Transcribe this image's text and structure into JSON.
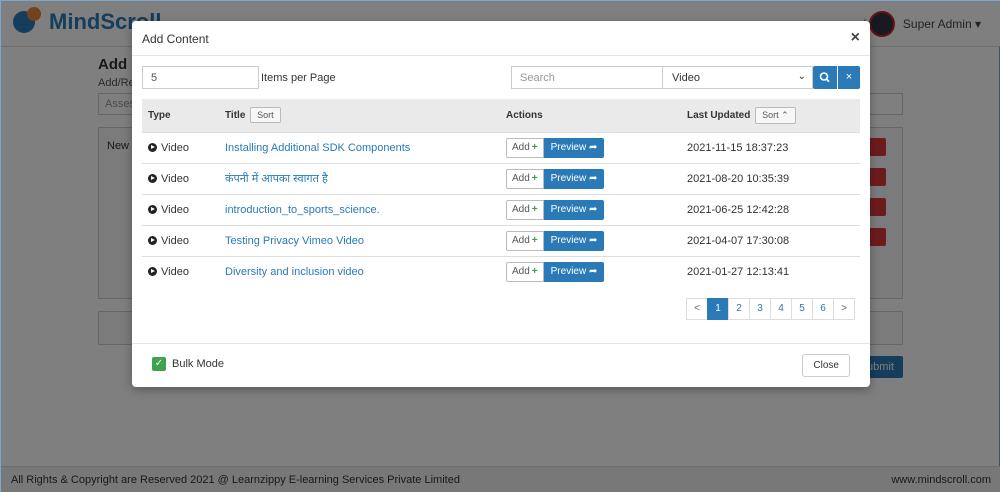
{
  "background": {
    "logo_text": "MindScroll",
    "user_name": "Super Admin ▾",
    "page_title": "Add Co",
    "page_sub": "Add/Re",
    "assess_placeholder": "Assess",
    "box_label": "New S",
    "submit_label": "ubmit",
    "footer_left": "All Rights & Copyright are Reserved 2021 @ Learnzippy E-learning Services Private Limited",
    "footer_right": "www.mindscroll.com"
  },
  "modal": {
    "title": "Add Content",
    "close_glyph": "×",
    "items_per_page_value": "5",
    "items_per_page_label": "Items per Page",
    "search_placeholder": "Search",
    "type_selected": "Video",
    "clear_glyph": "×",
    "columns": {
      "type": "Type",
      "title": "Title",
      "title_sort": "Sort",
      "actions": "Actions",
      "last_updated": "Last Updated",
      "last_updated_sort": "Sort ⌃"
    },
    "add_label": "Add",
    "preview_label": "Preview",
    "rows": [
      {
        "type": "Video",
        "title": "Installing Additional SDK Components",
        "date": "2021-11-15 18:37:23"
      },
      {
        "type": "Video",
        "title": "कंपनी में आपका स्वागत है",
        "date": "2021-08-20 10:35:39"
      },
      {
        "type": "Video",
        "title": "introduction_to_sports_science.",
        "date": "2021-06-25 12:42:28"
      },
      {
        "type": "Video",
        "title": "Testing Privacy Vimeo Video",
        "date": "2021-04-07 17:30:08"
      },
      {
        "type": "Video",
        "title": "Diversity and inclusion video",
        "date": "2021-01-27 12:13:41"
      }
    ],
    "pagination": {
      "prev": "<",
      "pages": [
        "1",
        "2",
        "3",
        "4",
        "5",
        "6"
      ],
      "next": ">",
      "active_page": "1"
    },
    "bulk_mode_label": "Bulk Mode",
    "bulk_mode_checked": true,
    "close_button_label": "Close"
  },
  "colors": {
    "primary": "#2a7ab8",
    "success": "#3fa34d",
    "danger": "#d9363e"
  }
}
